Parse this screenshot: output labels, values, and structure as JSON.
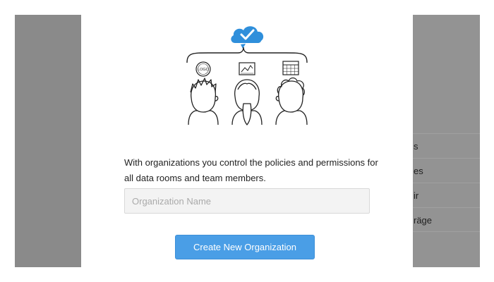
{
  "background": {
    "list_items": [
      "s",
      "es",
      "ir",
      "räge"
    ]
  },
  "modal": {
    "illustration": {
      "logo_text": "LOGO",
      "icons": [
        "cloud-check-icon",
        "logo-badge-icon",
        "chart-icon",
        "calendar-icon"
      ]
    },
    "description": "With organizations you control the policies and permissions for all data rooms and team members.",
    "org_name_input": {
      "value": "",
      "placeholder": "Organization Name"
    },
    "create_button_label": "Create New Organization"
  },
  "colors": {
    "accent": "#4a9ee6",
    "cloud": "#2f8fdb",
    "overlay": "#8a8a8a"
  }
}
